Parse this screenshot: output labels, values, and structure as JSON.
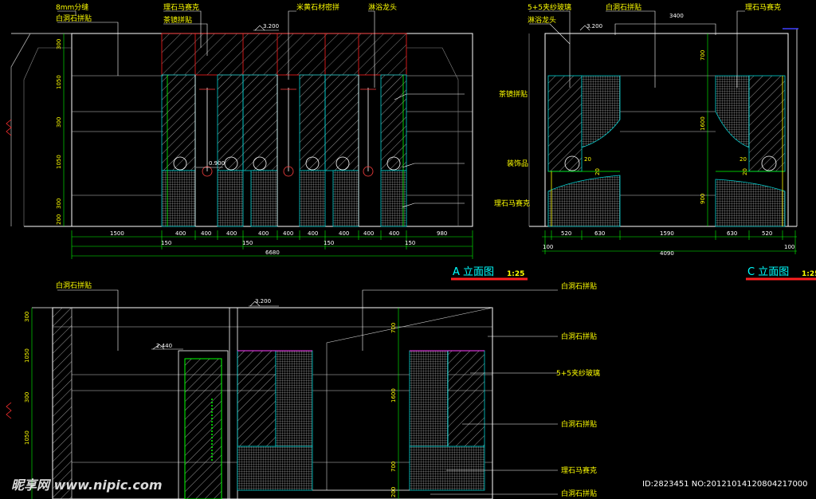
{
  "elevation_a": {
    "title": "A 立面图",
    "scale": "1:25",
    "top_labels": [
      "8mm分缝",
      "白洞石拼贴",
      "理石马赛克",
      "茶镜拼贴",
      "米黄石材密拼",
      "淋浴龙头"
    ],
    "right_labels": [
      "茶镜拼贴",
      "装饰品",
      "理石马赛克"
    ],
    "top_dim": "3.200",
    "dim_900": "0.900",
    "left_dims": [
      "300",
      "1050",
      "300",
      "1050",
      "300",
      "200"
    ],
    "bottom_dims": [
      "1500",
      "400",
      "400",
      "400",
      "400",
      "400",
      "400",
      "400",
      "400",
      "400",
      "980"
    ],
    "sub_dims": [
      "150",
      "150",
      "150",
      "150"
    ],
    "total": "6680"
  },
  "elevation_c": {
    "title": "C 立面图",
    "scale": "1:25",
    "top_labels": [
      "5+5夹纱玻璃",
      "淋浴龙头",
      "白洞石拼贴",
      "理石马赛克"
    ],
    "top_dims": [
      "3.200",
      "3400"
    ],
    "right_dims": [
      "700",
      "1600",
      "900"
    ],
    "small_dims": [
      "20",
      "20",
      "20",
      "20"
    ],
    "bottom_dims": [
      "100",
      "520",
      "630",
      "1590",
      "630",
      "520",
      "100"
    ],
    "total": "4090"
  },
  "elevation_b": {
    "top_label": "白洞石拼贴",
    "top_dims": [
      "3.200",
      "2.440"
    ],
    "left_dims": [
      "300",
      "1050",
      "300",
      "1050"
    ],
    "right_dims": [
      "700",
      "1600",
      "700",
      "200"
    ],
    "right_labels": [
      "白洞石拼贴",
      "白洞石拼贴",
      "5+5夹纱玻璃",
      "白洞石拼贴",
      "理石马赛克",
      "白洞石拼贴"
    ]
  },
  "watermark": "昵享网 www.nipic.com",
  "image_id": "ID:2823451 NO:20121014120804217000"
}
